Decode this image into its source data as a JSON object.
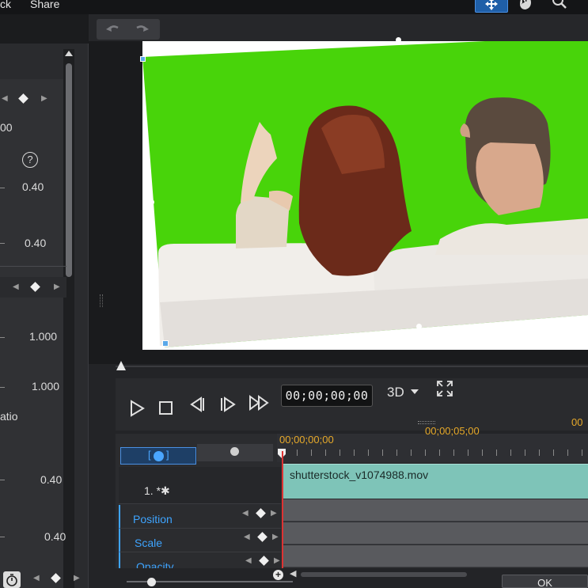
{
  "menu": {
    "item1": "ck",
    "item2": "Share"
  },
  "left_panel": {
    "values": [
      "00",
      "0.40",
      "0.40",
      "1.000",
      "1.000",
      "0.40",
      "0.40"
    ],
    "partial_label": "atio",
    "help_icon": "?"
  },
  "playback": {
    "timecode": "00;00;00;00",
    "mode_label": "3D"
  },
  "timeline": {
    "ruler": [
      "00;00;00;00",
      "00;00;05;00",
      "00"
    ],
    "track_number": "1. *✱",
    "clip_name": "shutterstock_v1074988.mov",
    "properties": [
      "Position",
      "Scale",
      "Opacity"
    ]
  },
  "footer": {
    "ok_label": "OK"
  },
  "colors": {
    "chroma_green": "#48d40a",
    "clip_teal": "#7ec4b8",
    "timecode_orange": "#e6a92a",
    "property_blue": "#3ea4ff",
    "playhead_red": "#dd3333"
  }
}
